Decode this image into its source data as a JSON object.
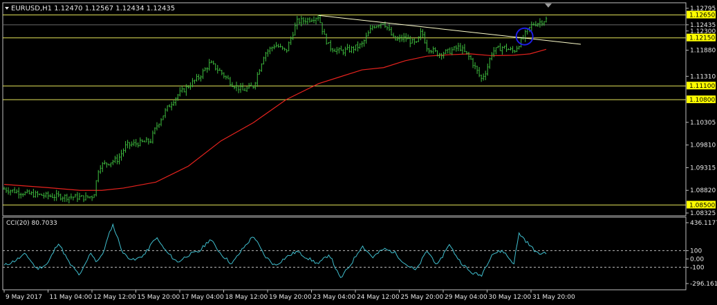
{
  "colors": {
    "background": "#000000",
    "frame": "#c0c0c0",
    "candles": "#3fbf3f",
    "ma": "#e8231e",
    "hline": "#e6e65a",
    "trendline": "#ffffcc",
    "highlight_box": "#ffff00",
    "circle": "#1e1ee6",
    "cci": "#40c0d0",
    "text": "#e8e8e8",
    "dash": "#c0c0c0"
  },
  "header": {
    "symbol_line": "EURUSD,H1  1.12470 1.12567 1.12434 1.12435"
  },
  "chart_data": [
    {
      "type": "candlestick",
      "symbol": "EURUSD",
      "timeframe": "H1",
      "ohlc_current": {
        "open": 1.1247,
        "high": 1.12567,
        "low": 1.12434,
        "close": 1.12435
      },
      "ylim": [
        1.08325,
        1.12795
      ],
      "y_ticks": [
        "1.12795",
        "1.12435",
        "1.12300",
        "1.11880",
        "1.11310",
        "1.10305",
        "1.09810",
        "1.09315",
        "1.08820",
        "1.08325"
      ],
      "x_labels": [
        "9 May 2017",
        "11 May 04:00",
        "12 May 12:00",
        "15 May 20:00",
        "17 May 04:00",
        "18 May 12:00",
        "19 May 20:00",
        "23 May 04:00",
        "24 May 12:00",
        "25 May 20:00",
        "29 May 04:00",
        "30 May 12:00",
        "31 May 20:00"
      ],
      "horizontal_levels": [
        {
          "label": "1.12650",
          "value": 1.1265
        },
        {
          "label": "1.12150",
          "value": 1.1215
        },
        {
          "label": "1.11100",
          "value": 1.111
        },
        {
          "label": "1.10800",
          "value": 1.108
        },
        {
          "label": "1.08500",
          "value": 1.085
        }
      ],
      "current_price_line": {
        "label": "1.12435",
        "value": 1.12435
      },
      "trendline": {
        "from": {
          "x": 0.58,
          "y": 1.1264
        },
        "to": {
          "x": 1.0,
          "y": 1.1207
        }
      },
      "close_path": [
        [
          0.0,
          1.0885
        ],
        [
          0.04,
          1.0875
        ],
        [
          0.08,
          1.087
        ],
        [
          0.12,
          1.0868
        ],
        [
          0.15,
          1.0866
        ],
        [
          0.165,
          1.087
        ],
        [
          0.175,
          1.0935
        ],
        [
          0.21,
          1.095
        ],
        [
          0.225,
          1.098
        ],
        [
          0.27,
          1.099
        ],
        [
          0.28,
          1.102
        ],
        [
          0.3,
          1.106
        ],
        [
          0.32,
          1.109
        ],
        [
          0.34,
          1.111
        ],
        [
          0.36,
          1.113
        ],
        [
          0.38,
          1.116
        ],
        [
          0.4,
          1.114
        ],
        [
          0.42,
          1.1115
        ],
        [
          0.44,
          1.11
        ],
        [
          0.46,
          1.111
        ],
        [
          0.48,
          1.118
        ],
        [
          0.5,
          1.12
        ],
        [
          0.52,
          1.1185
        ],
        [
          0.54,
          1.125
        ],
        [
          0.56,
          1.1255
        ],
        [
          0.58,
          1.1262
        ],
        [
          0.59,
          1.122
        ],
        [
          0.6,
          1.1195
        ],
        [
          0.62,
          1.1185
        ],
        [
          0.64,
          1.119
        ],
        [
          0.66,
          1.12
        ],
        [
          0.68,
          1.124
        ],
        [
          0.7,
          1.125
        ],
        [
          0.72,
          1.121
        ],
        [
          0.74,
          1.1215
        ],
        [
          0.76,
          1.12
        ],
        [
          0.77,
          1.123
        ],
        [
          0.78,
          1.1195
        ],
        [
          0.8,
          1.118
        ],
        [
          0.82,
          1.1185
        ],
        [
          0.84,
          1.1195
        ],
        [
          0.86,
          1.117
        ],
        [
          0.88,
          1.1125
        ],
        [
          0.89,
          1.1145
        ],
        [
          0.9,
          1.1185
        ],
        [
          0.92,
          1.1195
        ],
        [
          0.94,
          1.1185
        ],
        [
          0.955,
          1.121
        ],
        [
          0.965,
          1.123
        ],
        [
          0.975,
          1.1245
        ],
        [
          0.985,
          1.1248
        ],
        [
          1.0,
          1.1255
        ]
      ],
      "ma_path": [
        [
          0.0,
          1.0895
        ],
        [
          0.08,
          1.0888
        ],
        [
          0.14,
          1.0882
        ],
        [
          0.18,
          1.0882
        ],
        [
          0.22,
          1.0887
        ],
        [
          0.28,
          1.09
        ],
        [
          0.34,
          1.0935
        ],
        [
          0.4,
          1.099
        ],
        [
          0.46,
          1.103
        ],
        [
          0.52,
          1.108
        ],
        [
          0.58,
          1.1115
        ],
        [
          0.62,
          1.113
        ],
        [
          0.66,
          1.1145
        ],
        [
          0.7,
          1.115
        ],
        [
          0.74,
          1.1165
        ],
        [
          0.78,
          1.1175
        ],
        [
          0.82,
          1.1178
        ],
        [
          0.86,
          1.118
        ],
        [
          0.9,
          1.1176
        ],
        [
          0.94,
          1.1177
        ],
        [
          0.97,
          1.118
        ],
        [
          1.0,
          1.119
        ]
      ],
      "highlight_circle": {
        "x": 0.96,
        "y": 1.1218
      }
    },
    {
      "type": "line",
      "name": "CCI(20)",
      "label": "CCI(20) 80.7033",
      "value": 80.7033,
      "ylim": [
        -296.1613,
        436.1177
      ],
      "y_ticks": [
        "436.1177",
        "100",
        "0.00",
        "-100",
        "-296.1613"
      ],
      "levels": [
        100,
        -100
      ],
      "path": [
        [
          0.0,
          -80
        ],
        [
          0.02,
          -20
        ],
        [
          0.04,
          60
        ],
        [
          0.06,
          -120
        ],
        [
          0.08,
          -60
        ],
        [
          0.1,
          200
        ],
        [
          0.12,
          -50
        ],
        [
          0.14,
          -200
        ],
        [
          0.16,
          80
        ],
        [
          0.17,
          -30
        ],
        [
          0.18,
          30
        ],
        [
          0.2,
          420
        ],
        [
          0.22,
          60
        ],
        [
          0.24,
          -20
        ],
        [
          0.26,
          60
        ],
        [
          0.28,
          260
        ],
        [
          0.3,
          80
        ],
        [
          0.32,
          -40
        ],
        [
          0.34,
          50
        ],
        [
          0.36,
          90
        ],
        [
          0.38,
          240
        ],
        [
          0.4,
          60
        ],
        [
          0.42,
          -60
        ],
        [
          0.44,
          120
        ],
        [
          0.46,
          280
        ],
        [
          0.48,
          40
        ],
        [
          0.5,
          -80
        ],
        [
          0.52,
          20
        ],
        [
          0.54,
          90
        ],
        [
          0.56,
          10
        ],
        [
          0.58,
          -60
        ],
        [
          0.6,
          60
        ],
        [
          0.62,
          -240
        ],
        [
          0.64,
          -60
        ],
        [
          0.66,
          160
        ],
        [
          0.68,
          20
        ],
        [
          0.7,
          120
        ],
        [
          0.72,
          80
        ],
        [
          0.74,
          -60
        ],
        [
          0.76,
          -140
        ],
        [
          0.78,
          100
        ],
        [
          0.8,
          -80
        ],
        [
          0.82,
          180
        ],
        [
          0.84,
          -20
        ],
        [
          0.86,
          -160
        ],
        [
          0.88,
          -200
        ],
        [
          0.9,
          60
        ],
        [
          0.92,
          100
        ],
        [
          0.94,
          -60
        ],
        [
          0.95,
          310
        ],
        [
          0.97,
          160
        ],
        [
          0.985,
          60
        ],
        [
          1.0,
          80
        ]
      ]
    }
  ]
}
